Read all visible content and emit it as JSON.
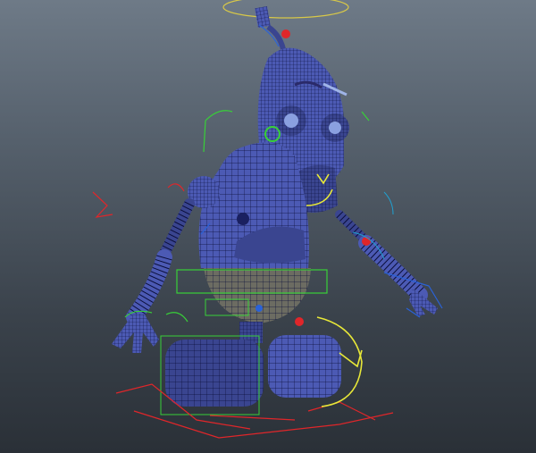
{
  "viewport": {
    "background_top": "#6e7a87",
    "background_bottom": "#2a3037"
  },
  "colors": {
    "wireframe": "#0b0f3a",
    "mesh_fill": "#4c5ab4",
    "selected_mesh": "#6c6c62",
    "control_red": "#e0262a",
    "control_green": "#38d038",
    "control_yellow": "#e8e838",
    "control_blue": "#2a62d8",
    "control_cyan": "#20a0d0"
  },
  "model": {
    "subject": "robot-character-rig"
  }
}
